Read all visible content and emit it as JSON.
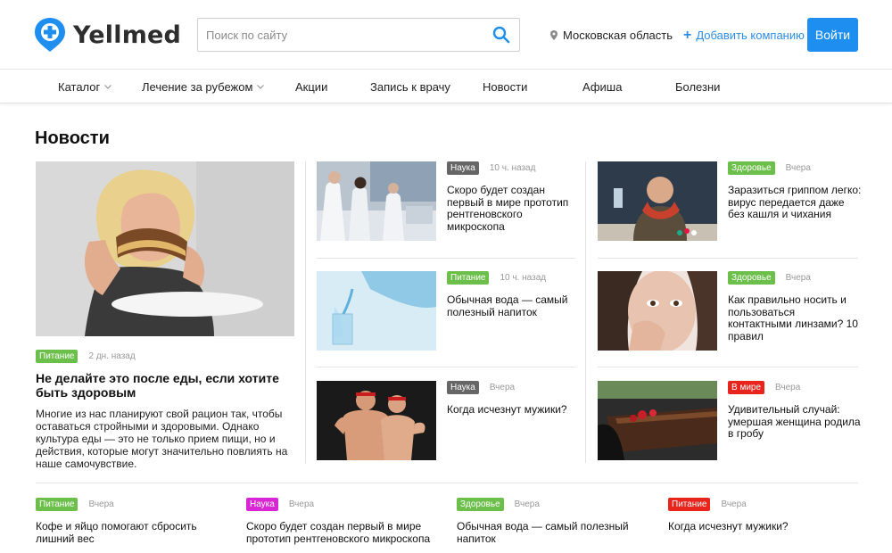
{
  "brand": {
    "name": "Yellmed",
    "color": "#1e8ff0"
  },
  "header": {
    "search_placeholder": "Поиск по сайту",
    "region": "Московская область",
    "add_company": "Добавить компанию",
    "login": "Войти"
  },
  "nav": {
    "items": [
      {
        "label": "Каталог",
        "dropdown": true
      },
      {
        "label": "Лечение за рубежом",
        "dropdown": true
      },
      {
        "label": "Акции",
        "dropdown": false
      },
      {
        "label": "Запись к врачу",
        "dropdown": false
      },
      {
        "label": "Новости",
        "dropdown": false
      },
      {
        "label": "Афиша",
        "dropdown": false
      },
      {
        "label": "Болезни",
        "dropdown": false
      }
    ]
  },
  "news": {
    "title": "Новости",
    "featured": {
      "tag": "Питание",
      "tag_color": "#6cbf4a",
      "time": "2 дн. назад",
      "title": "Не делайте это после еды, если хотите быть здоровым",
      "text": "Многие из нас планируют свой рацион так, чтобы оставаться стройными и здоровыми. Однако культура еды — это не только прием пищи, но и действия, которые могут значительно повлиять на наше самочувствие.",
      "image": "woman-eating-cake-photo"
    },
    "cards": [
      {
        "tag": "Наука",
        "tag_color": "#666666",
        "time": "10 ч. назад",
        "title": "Скоро будет создан первый в мире прототип рентгеновского микроскопа",
        "image": "laboratory-scientists-photo"
      },
      {
        "tag": "Здоровье",
        "tag_color": "#6cbf4a",
        "time": "Вчера",
        "title": "Заразиться гриппом легко: вирус передается даже без кашля и чихания",
        "image": "sick-man-with-pills-photo"
      },
      {
        "tag": "Питание",
        "tag_color": "#6cbf4a",
        "time": "10 ч. назад",
        "title": "Обычная вода — самый полезный напиток",
        "image": "water-pitcher-glass-photo"
      },
      {
        "tag": "Здоровье",
        "tag_color": "#6cbf4a",
        "time": "Вчера",
        "title": "Как правильно носить и пользоваться контактными линзами? 10 правил",
        "image": "woman-contact-lens-photo"
      },
      {
        "tag": "Наука",
        "tag_color": "#666666",
        "time": "Вчера",
        "title": "Когда исчезнут мужики?",
        "image": "two-men-posing-photo"
      },
      {
        "tag": "В мире",
        "tag_color": "#e8241c",
        "time": "Вчера",
        "title": "Удивительный случай: умершая женщина родила в гробу",
        "image": "coffin-roses-photo"
      }
    ],
    "bottom": [
      {
        "tag": "Питание",
        "tag_color": "#6cbf4a",
        "time": "Вчера",
        "title": "Кофе и яйцо помогают сбросить лишний вес"
      },
      {
        "tag": "Наука",
        "tag_color": "#d926d4",
        "time": "Вчера",
        "title": "Скоро будет создан первый в мире прототип рентгеновского микроскопа"
      },
      {
        "tag": "Здоровье",
        "tag_color": "#6cbf4a",
        "time": "Вчера",
        "title": "Обычная вода — самый полезный напиток"
      },
      {
        "tag": "Питание",
        "tag_color": "#e8241c",
        "time": "Вчера",
        "title": "Когда исчезнут мужики?"
      }
    ]
  }
}
